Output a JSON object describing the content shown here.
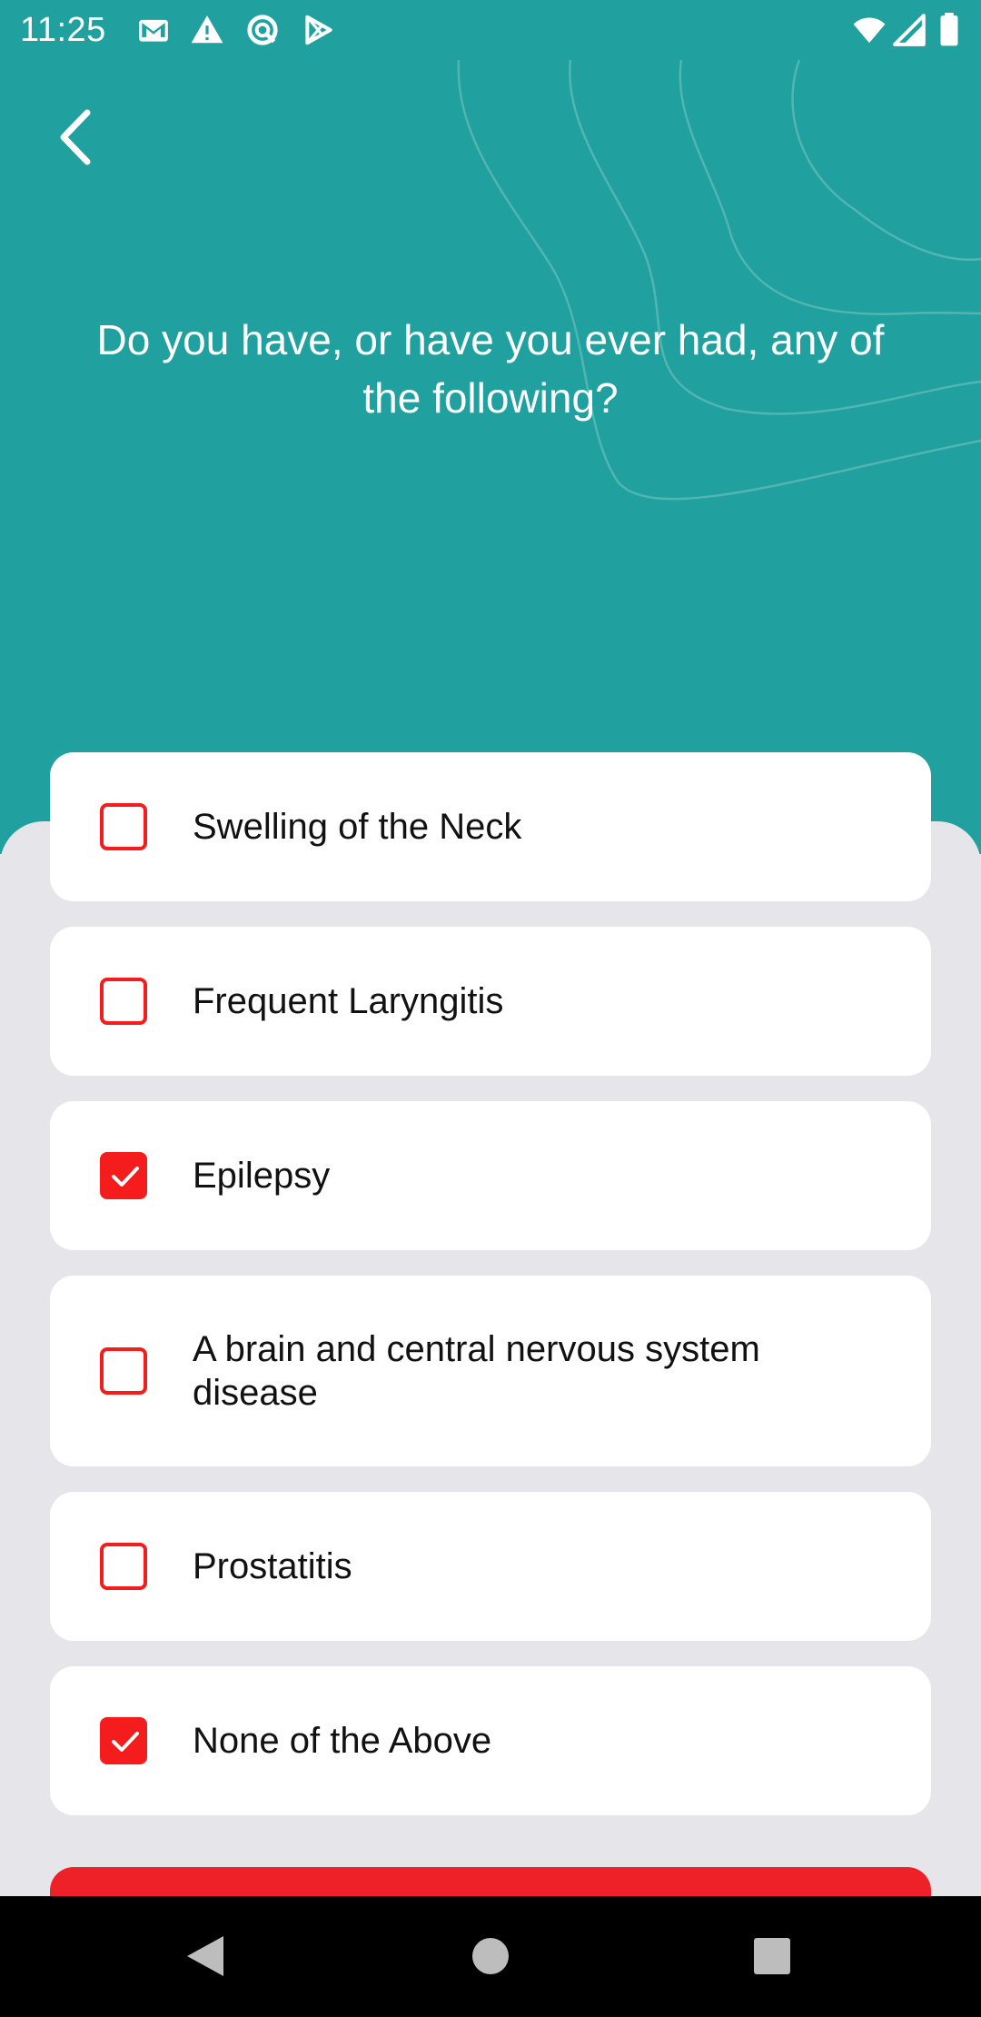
{
  "status_bar": {
    "time": "11:25",
    "left_icons": [
      "gmail-icon",
      "warning-icon",
      "sync-icon",
      "play-store-icon"
    ],
    "right_icons": [
      "wifi-icon",
      "signal-icon",
      "battery-icon"
    ]
  },
  "header": {
    "back_icon": "chevron-left-icon",
    "question": "Do you have, or have you ever had, any of the following?"
  },
  "options": [
    {
      "label": "Swelling of the Neck",
      "checked": false
    },
    {
      "label": "Frequent Laryngitis",
      "checked": false
    },
    {
      "label": "Epilepsy",
      "checked": true
    },
    {
      "label": "A brain and central nervous system disease",
      "checked": false
    },
    {
      "label": "Prostatitis",
      "checked": false
    },
    {
      "label": "None of the Above",
      "checked": true
    }
  ],
  "colors": {
    "header_bg": "#20a09e",
    "accent": "#f41c1c",
    "button": "#ee2028",
    "sheet_bg": "#e6e6ea"
  },
  "nav_bar": {
    "icons": [
      "back-triangle-icon",
      "home-circle-icon",
      "recents-square-icon"
    ]
  }
}
